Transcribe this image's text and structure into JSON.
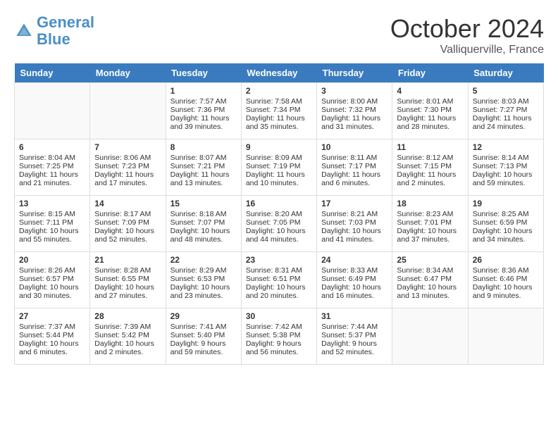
{
  "header": {
    "logo_general": "General",
    "logo_blue": "Blue",
    "month": "October 2024",
    "location": "Valliquerville, France"
  },
  "weekdays": [
    "Sunday",
    "Monday",
    "Tuesday",
    "Wednesday",
    "Thursday",
    "Friday",
    "Saturday"
  ],
  "weeks": [
    [
      {
        "day": "",
        "sunrise": "",
        "sunset": "",
        "daylight": ""
      },
      {
        "day": "",
        "sunrise": "",
        "sunset": "",
        "daylight": ""
      },
      {
        "day": "1",
        "sunrise": "Sunrise: 7:57 AM",
        "sunset": "Sunset: 7:36 PM",
        "daylight": "Daylight: 11 hours and 39 minutes."
      },
      {
        "day": "2",
        "sunrise": "Sunrise: 7:58 AM",
        "sunset": "Sunset: 7:34 PM",
        "daylight": "Daylight: 11 hours and 35 minutes."
      },
      {
        "day": "3",
        "sunrise": "Sunrise: 8:00 AM",
        "sunset": "Sunset: 7:32 PM",
        "daylight": "Daylight: 11 hours and 31 minutes."
      },
      {
        "day": "4",
        "sunrise": "Sunrise: 8:01 AM",
        "sunset": "Sunset: 7:30 PM",
        "daylight": "Daylight: 11 hours and 28 minutes."
      },
      {
        "day": "5",
        "sunrise": "Sunrise: 8:03 AM",
        "sunset": "Sunset: 7:27 PM",
        "daylight": "Daylight: 11 hours and 24 minutes."
      }
    ],
    [
      {
        "day": "6",
        "sunrise": "Sunrise: 8:04 AM",
        "sunset": "Sunset: 7:25 PM",
        "daylight": "Daylight: 11 hours and 21 minutes."
      },
      {
        "day": "7",
        "sunrise": "Sunrise: 8:06 AM",
        "sunset": "Sunset: 7:23 PM",
        "daylight": "Daylight: 11 hours and 17 minutes."
      },
      {
        "day": "8",
        "sunrise": "Sunrise: 8:07 AM",
        "sunset": "Sunset: 7:21 PM",
        "daylight": "Daylight: 11 hours and 13 minutes."
      },
      {
        "day": "9",
        "sunrise": "Sunrise: 8:09 AM",
        "sunset": "Sunset: 7:19 PM",
        "daylight": "Daylight: 11 hours and 10 minutes."
      },
      {
        "day": "10",
        "sunrise": "Sunrise: 8:11 AM",
        "sunset": "Sunset: 7:17 PM",
        "daylight": "Daylight: 11 hours and 6 minutes."
      },
      {
        "day": "11",
        "sunrise": "Sunrise: 8:12 AM",
        "sunset": "Sunset: 7:15 PM",
        "daylight": "Daylight: 11 hours and 2 minutes."
      },
      {
        "day": "12",
        "sunrise": "Sunrise: 8:14 AM",
        "sunset": "Sunset: 7:13 PM",
        "daylight": "Daylight: 10 hours and 59 minutes."
      }
    ],
    [
      {
        "day": "13",
        "sunrise": "Sunrise: 8:15 AM",
        "sunset": "Sunset: 7:11 PM",
        "daylight": "Daylight: 10 hours and 55 minutes."
      },
      {
        "day": "14",
        "sunrise": "Sunrise: 8:17 AM",
        "sunset": "Sunset: 7:09 PM",
        "daylight": "Daylight: 10 hours and 52 minutes."
      },
      {
        "day": "15",
        "sunrise": "Sunrise: 8:18 AM",
        "sunset": "Sunset: 7:07 PM",
        "daylight": "Daylight: 10 hours and 48 minutes."
      },
      {
        "day": "16",
        "sunrise": "Sunrise: 8:20 AM",
        "sunset": "Sunset: 7:05 PM",
        "daylight": "Daylight: 10 hours and 44 minutes."
      },
      {
        "day": "17",
        "sunrise": "Sunrise: 8:21 AM",
        "sunset": "Sunset: 7:03 PM",
        "daylight": "Daylight: 10 hours and 41 minutes."
      },
      {
        "day": "18",
        "sunrise": "Sunrise: 8:23 AM",
        "sunset": "Sunset: 7:01 PM",
        "daylight": "Daylight: 10 hours and 37 minutes."
      },
      {
        "day": "19",
        "sunrise": "Sunrise: 8:25 AM",
        "sunset": "Sunset: 6:59 PM",
        "daylight": "Daylight: 10 hours and 34 minutes."
      }
    ],
    [
      {
        "day": "20",
        "sunrise": "Sunrise: 8:26 AM",
        "sunset": "Sunset: 6:57 PM",
        "daylight": "Daylight: 10 hours and 30 minutes."
      },
      {
        "day": "21",
        "sunrise": "Sunrise: 8:28 AM",
        "sunset": "Sunset: 6:55 PM",
        "daylight": "Daylight: 10 hours and 27 minutes."
      },
      {
        "day": "22",
        "sunrise": "Sunrise: 8:29 AM",
        "sunset": "Sunset: 6:53 PM",
        "daylight": "Daylight: 10 hours and 23 minutes."
      },
      {
        "day": "23",
        "sunrise": "Sunrise: 8:31 AM",
        "sunset": "Sunset: 6:51 PM",
        "daylight": "Daylight: 10 hours and 20 minutes."
      },
      {
        "day": "24",
        "sunrise": "Sunrise: 8:33 AM",
        "sunset": "Sunset: 6:49 PM",
        "daylight": "Daylight: 10 hours and 16 minutes."
      },
      {
        "day": "25",
        "sunrise": "Sunrise: 8:34 AM",
        "sunset": "Sunset: 6:47 PM",
        "daylight": "Daylight: 10 hours and 13 minutes."
      },
      {
        "day": "26",
        "sunrise": "Sunrise: 8:36 AM",
        "sunset": "Sunset: 6:46 PM",
        "daylight": "Daylight: 10 hours and 9 minutes."
      }
    ],
    [
      {
        "day": "27",
        "sunrise": "Sunrise: 7:37 AM",
        "sunset": "Sunset: 5:44 PM",
        "daylight": "Daylight: 10 hours and 6 minutes."
      },
      {
        "day": "28",
        "sunrise": "Sunrise: 7:39 AM",
        "sunset": "Sunset: 5:42 PM",
        "daylight": "Daylight: 10 hours and 2 minutes."
      },
      {
        "day": "29",
        "sunrise": "Sunrise: 7:41 AM",
        "sunset": "Sunset: 5:40 PM",
        "daylight": "Daylight: 9 hours and 59 minutes."
      },
      {
        "day": "30",
        "sunrise": "Sunrise: 7:42 AM",
        "sunset": "Sunset: 5:38 PM",
        "daylight": "Daylight: 9 hours and 56 minutes."
      },
      {
        "day": "31",
        "sunrise": "Sunrise: 7:44 AM",
        "sunset": "Sunset: 5:37 PM",
        "daylight": "Daylight: 9 hours and 52 minutes."
      },
      {
        "day": "",
        "sunrise": "",
        "sunset": "",
        "daylight": ""
      },
      {
        "day": "",
        "sunrise": "",
        "sunset": "",
        "daylight": ""
      }
    ]
  ]
}
